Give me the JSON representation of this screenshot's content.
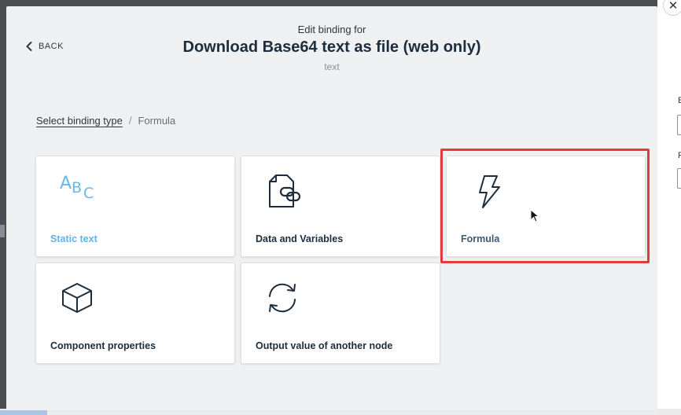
{
  "header": {
    "pre_title": "Edit binding for",
    "title": "Download Base64 text as file (web only)",
    "subtitle": "text"
  },
  "back": {
    "label": "BACK"
  },
  "breadcrumb": {
    "link": "Select binding type",
    "separator": "/",
    "current": "Formula"
  },
  "cards": {
    "static_text": {
      "label": "Static text",
      "icon": "abc-icon"
    },
    "data_variables": {
      "label": "Data and Variables",
      "icon": "document-link-icon"
    },
    "formula": {
      "label": "Formula",
      "icon": "lightning-icon"
    },
    "component_properties": {
      "label": "Component properties",
      "icon": "cube-icon"
    },
    "output_value": {
      "label": "Output value of another node",
      "icon": "refresh-icon"
    }
  },
  "colors": {
    "highlight": "#e03c3c",
    "static_text": "#5fb4e8",
    "modal_bg": "#eff0f1"
  }
}
